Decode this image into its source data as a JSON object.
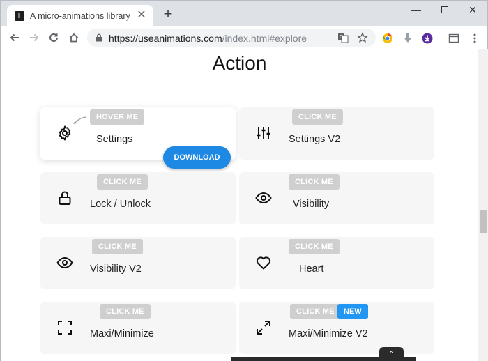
{
  "browser": {
    "tab_title": "A micro-animations library",
    "tab_close": "✕",
    "new_tab": "+",
    "url_host": "https://useanimations.com",
    "url_path": "/index.html#explore",
    "win_min": "—",
    "win_close": "✕"
  },
  "page": {
    "heading": "Action",
    "download_label": "DOWNLOAD",
    "scroll_top_label": "⌃"
  },
  "cards": [
    {
      "label": "Settings",
      "badge": "HOVER ME",
      "icon": "gear-icon"
    },
    {
      "label": "Settings V2",
      "badge": "CLICK ME",
      "icon": "sliders-icon"
    },
    {
      "label": "Lock / Unlock",
      "badge": "CLICK ME",
      "icon": "lock-icon"
    },
    {
      "label": "Visibility",
      "badge": "CLICK ME",
      "icon": "eye-icon"
    },
    {
      "label": "Visibility V2",
      "badge": "CLICK ME",
      "icon": "eye-icon"
    },
    {
      "label": "Heart",
      "badge": "CLICK ME",
      "icon": "heart-icon"
    },
    {
      "label": "Maxi/Minimize",
      "badge": "CLICK ME",
      "icon": "maximize-icon"
    },
    {
      "label": "Maxi/Minimize V2",
      "badge": "CLICK ME",
      "new_badge": "NEW",
      "icon": "expand-arrows-icon"
    }
  ],
  "colors": {
    "accent": "#1e88e5",
    "badge_bg": "#cfcfcf",
    "card_bg": "#f6f6f6",
    "new_badge": "#2196f3"
  }
}
